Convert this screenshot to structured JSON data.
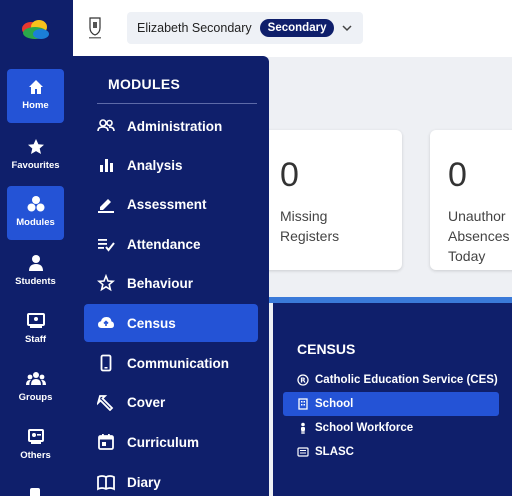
{
  "rail": {
    "items": [
      {
        "label": "Home",
        "icon": "home-icon",
        "active": true
      },
      {
        "label": "Favourites",
        "icon": "star-icon",
        "active": false
      },
      {
        "label": "Modules",
        "icon": "modules-icon",
        "active": true
      },
      {
        "label": "Students",
        "icon": "student-icon",
        "active": false
      },
      {
        "label": "Staff",
        "icon": "staff-icon",
        "active": false
      },
      {
        "label": "Groups",
        "icon": "groups-icon",
        "active": false
      },
      {
        "label": "Others",
        "icon": "others-icon",
        "active": false
      }
    ]
  },
  "header": {
    "school_name": "Elizabeth Secondary",
    "school_badge": "Secondary"
  },
  "cards": [
    {
      "value": "0",
      "label_line1": "Missing",
      "label_line2": "Registers",
      "label_line3": ""
    },
    {
      "value": "0",
      "label_line1": "Unauthor",
      "label_line2": "Absences",
      "label_line3": "Today"
    }
  ],
  "modules": {
    "title": "MODULES",
    "items": [
      {
        "label": "Administration",
        "icon": "people-icon"
      },
      {
        "label": "Analysis",
        "icon": "bar-chart-icon"
      },
      {
        "label": "Assessment",
        "icon": "pencil-icon"
      },
      {
        "label": "Attendance",
        "icon": "checklist-icon"
      },
      {
        "label": "Behaviour",
        "icon": "star-outline-icon"
      },
      {
        "label": "Census",
        "icon": "cloud-upload-icon",
        "active": true
      },
      {
        "label": "Communication",
        "icon": "phone-icon"
      },
      {
        "label": "Cover",
        "icon": "cover-icon"
      },
      {
        "label": "Curriculum",
        "icon": "calendar-icon"
      },
      {
        "label": "Diary",
        "icon": "book-icon"
      }
    ]
  },
  "census": {
    "title": "CENSUS",
    "items": [
      {
        "label": "Catholic Education Service (CES)",
        "icon": "registered-icon"
      },
      {
        "label": "School",
        "icon": "building-icon",
        "active": true
      },
      {
        "label": "School Workforce",
        "icon": "person-icon"
      },
      {
        "label": "SLASC",
        "icon": "list-icon"
      }
    ]
  },
  "colors": {
    "navy": "#0f1f6b",
    "accent": "#2453d6",
    "strip": "#3a7ad9"
  }
}
